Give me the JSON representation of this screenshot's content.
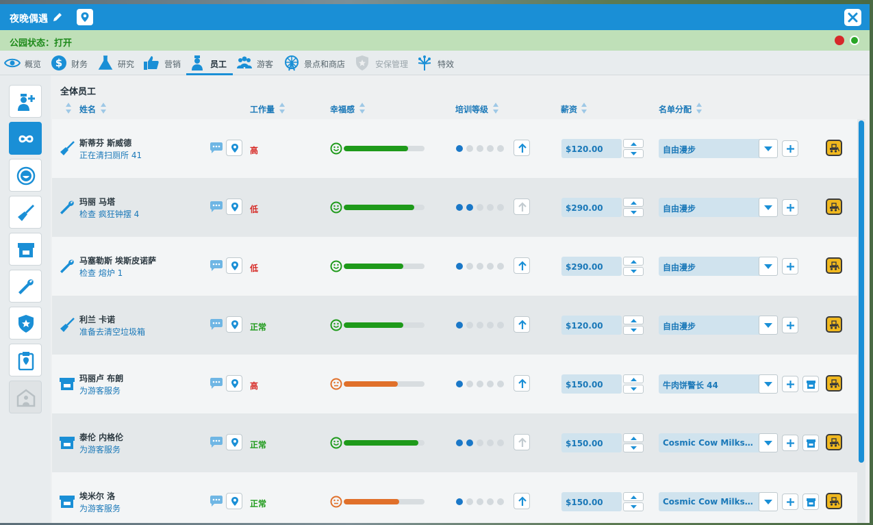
{
  "window": {
    "title": "夜晚偶遇"
  },
  "status": {
    "label": "公园状态：打开"
  },
  "tabs": [
    {
      "label": "概览",
      "icon": "eye-icon"
    },
    {
      "label": "财务",
      "icon": "dollar-icon"
    },
    {
      "label": "研究",
      "icon": "flask-icon"
    },
    {
      "label": "营销",
      "icon": "thumbs-up-icon"
    },
    {
      "label": "员工",
      "icon": "staff-icon"
    },
    {
      "label": "游客",
      "icon": "guests-icon"
    },
    {
      "label": "景点和商店",
      "icon": "ferris-wheel-icon"
    },
    {
      "label": "安保管理",
      "icon": "shield-icon"
    },
    {
      "label": "特效",
      "icon": "fireworks-icon"
    }
  ],
  "active_tab": "员工",
  "sidebar": [
    {
      "name": "hire-staff",
      "icon": "add-staff-icon"
    },
    {
      "name": "all-staff",
      "icon": "infinity-icon"
    },
    {
      "name": "entertainers",
      "icon": "smiley-icon"
    },
    {
      "name": "janitors",
      "icon": "broom-icon"
    },
    {
      "name": "vendors",
      "icon": "shop-icon"
    },
    {
      "name": "mechanics",
      "icon": "wrench-icon"
    },
    {
      "name": "security",
      "icon": "badge-icon"
    },
    {
      "name": "inspectors",
      "icon": "clipboard-icon"
    },
    {
      "name": "buildings",
      "icon": "staff-building-icon"
    }
  ],
  "section_title": "全体员工",
  "columns": {
    "name": "姓名",
    "workload": "工作量",
    "happiness": "幸福感",
    "training": "培训等级",
    "wage": "薪资",
    "assignment": "名单分配"
  },
  "staff": [
    {
      "type": "janitor",
      "name": "斯蒂芬 斯威德",
      "task": "正在清扫厕所 41",
      "workload": "高",
      "workload_level": "high",
      "mood": "happy",
      "happiness": 0.8,
      "training": 1,
      "can_train": true,
      "wage": "$120.00",
      "assignment": "自由漫步",
      "shop": false
    },
    {
      "type": "mechanic",
      "name": "玛丽 马塔",
      "task": "检查 疯狂钟摆 4",
      "workload": "低",
      "workload_level": "low",
      "mood": "happy",
      "happiness": 0.87,
      "training": 2,
      "can_train": false,
      "wage": "$290.00",
      "assignment": "自由漫步",
      "shop": false
    },
    {
      "type": "mechanic",
      "name": "马塞勒斯 埃斯皮诺萨",
      "task": "检查 熔炉 1",
      "workload": "低",
      "workload_level": "low",
      "mood": "happy",
      "happiness": 0.74,
      "training": 1,
      "can_train": true,
      "wage": "$290.00",
      "assignment": "自由漫步",
      "shop": false
    },
    {
      "type": "janitor",
      "name": "利兰 卡诺",
      "task": "准备去清空垃圾箱",
      "workload": "正常",
      "workload_level": "normal",
      "mood": "happy",
      "happiness": 0.74,
      "training": 1,
      "can_train": true,
      "wage": "$120.00",
      "assignment": "自由漫步",
      "shop": false
    },
    {
      "type": "vendor",
      "name": "玛丽卢 布朗",
      "task": "为游客服务",
      "workload": "高",
      "workload_level": "high",
      "mood": "neutral",
      "happiness": 0.67,
      "training": 1,
      "can_train": true,
      "wage": "$150.00",
      "assignment": "牛肉饼警长 44",
      "shop": true
    },
    {
      "type": "vendor",
      "name": "泰伦 内格伦",
      "task": "为游客服务",
      "workload": "正常",
      "workload_level": "normal",
      "mood": "happy",
      "happiness": 0.92,
      "training": 2,
      "can_train": false,
      "wage": "$150.00",
      "assignment": "Cosmic Cow Milksha...",
      "shop": true
    },
    {
      "type": "vendor",
      "name": "埃米尔 洛",
      "task": "为游客服务",
      "workload": "正常",
      "workload_level": "normal",
      "mood": "neutral",
      "happiness": 0.69,
      "training": 1,
      "can_train": true,
      "wage": "$150.00",
      "assignment": "Cosmic Cow Milksha...",
      "shop": true
    }
  ],
  "colors": {
    "accent": "#1a8fd6",
    "happy": "#1e9a1a",
    "neutral": "#e0702a",
    "warning": "#d62a26",
    "fire": "#f0b81e"
  }
}
